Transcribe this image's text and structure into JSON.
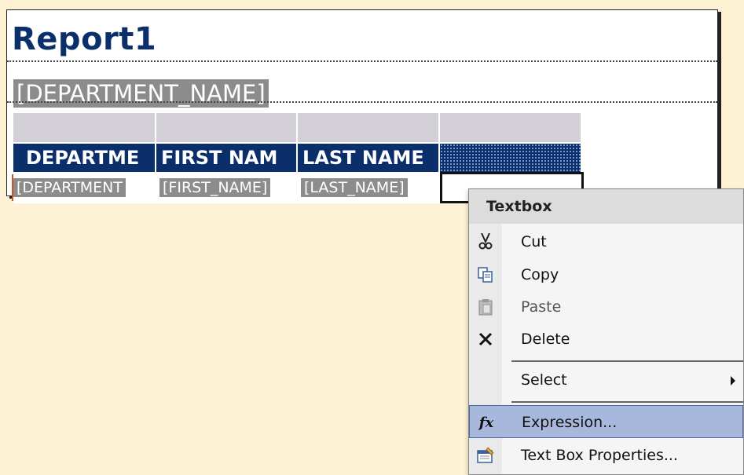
{
  "report": {
    "title": "Report1",
    "group_field": "[DEPARTMENT_NAME]",
    "table": {
      "headers": [
        "DEPARTME",
        "FIRST NAM",
        "LAST NAME",
        ""
      ],
      "detail": [
        "[DEPARTMENT",
        "[FIRST_NAME]",
        "[LAST_NAME]",
        ""
      ]
    }
  },
  "context_menu": {
    "header": "Textbox",
    "items": [
      {
        "label": "Cut",
        "icon": "scissors-icon",
        "enabled": true
      },
      {
        "label": "Copy",
        "icon": "copy-icon",
        "enabled": true
      },
      {
        "label": "Paste",
        "icon": "paste-icon",
        "enabled": false
      },
      {
        "label": "Delete",
        "icon": "delete-x-icon",
        "enabled": true
      },
      {
        "label": "Select",
        "icon": "",
        "enabled": true,
        "submenu": true
      },
      {
        "label": "Expression...",
        "icon": "fx-icon",
        "enabled": true,
        "highlighted": true
      },
      {
        "label": "Text Box Properties...",
        "icon": "properties-icon",
        "enabled": true
      }
    ]
  },
  "colors": {
    "canvas": "#fdf3d4",
    "header_fill": "#0b2f6b",
    "title": "#0b2f6b",
    "field_fill": "#8c8c8c",
    "menu_highlight": "#a8b8dc"
  }
}
